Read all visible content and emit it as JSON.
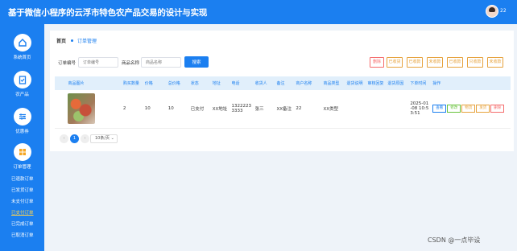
{
  "app": {
    "title": "基于微信小程序的云浮市特色农产品交易的设计与实现",
    "user": "22"
  },
  "sidebar": {
    "items": [
      {
        "label": "系统首页",
        "icon": "home-icon"
      },
      {
        "label": "农产品",
        "icon": "clipboard-icon"
      },
      {
        "label": "优惠券",
        "icon": "sliders-icon"
      },
      {
        "label": "订单管理",
        "icon": "grid-icon"
      }
    ],
    "sub_items": [
      "已退款订单",
      "已发货订单",
      "未支付订单",
      "已支付订单",
      "已完成订单",
      "已取消订单"
    ],
    "active_sub": "已支付订单"
  },
  "breadcrumb": {
    "home": "首页",
    "current": "订单管理"
  },
  "search": {
    "order_no_label": "订单编号",
    "order_no_placeholder": "订单编号",
    "product_label": "商品名称",
    "product_placeholder": "商品名称",
    "button": "搜索"
  },
  "actions": [
    {
      "label": "删除",
      "color": "#f56c6c"
    },
    {
      "label": "已收货",
      "color": "#e6a23c"
    },
    {
      "label": "已收款",
      "color": "#e6a23c"
    },
    {
      "label": "未收款",
      "color": "#e6a23c"
    },
    {
      "label": "已收款",
      "color": "#e6a23c"
    },
    {
      "label": "只收款",
      "color": "#e6a23c"
    },
    {
      "label": "未收款",
      "color": "#e6a23c"
    }
  ],
  "table": {
    "columns": [
      "",
      "商品图片",
      "购买数量",
      "价格",
      "总价格",
      "状态",
      "地址",
      "电话",
      "收货人",
      "备注",
      "商户名称",
      "商品类型",
      "退货说明",
      "审核回复",
      "退货原因",
      "下单时间",
      "操作"
    ],
    "rows": [
      {
        "quantity": "2",
        "price": "10",
        "total": "10",
        "status": "已支付",
        "address": "XX地址",
        "phone": "13222233333",
        "consignee": "张三",
        "note": "XX备注",
        "merchant": "22",
        "type": "XX类型",
        "time": "2025-01-08 10:53:51"
      }
    ],
    "row_actions": [
      {
        "label": "查看",
        "color": "#1b7ff0"
      },
      {
        "label": "修改",
        "color": "#67c23a"
      },
      {
        "label": "物流",
        "color": "#e6a23c"
      },
      {
        "label": "发货",
        "color": "#e6a23c"
      },
      {
        "label": "删除",
        "color": "#f56c6c"
      }
    ]
  },
  "pagination": {
    "current": "1",
    "page_size": "10条/页"
  },
  "watermark": "CSDN @一点毕设"
}
